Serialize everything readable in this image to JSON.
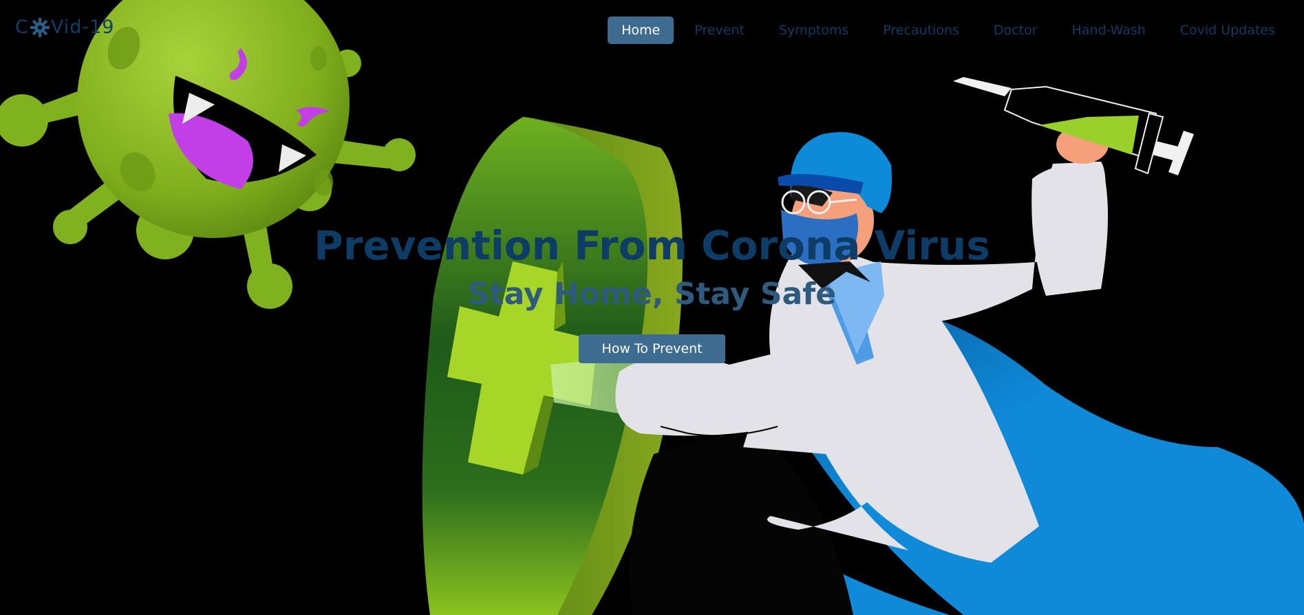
{
  "logo": {
    "text_before": "C",
    "text_after": "Vid-19",
    "icon": "virus-gear-icon"
  },
  "nav": {
    "items": [
      {
        "label": "Home",
        "active": true
      },
      {
        "label": "Prevent",
        "active": false
      },
      {
        "label": "Symptoms",
        "active": false
      },
      {
        "label": "Precautions",
        "active": false
      },
      {
        "label": "Doctor",
        "active": false
      },
      {
        "label": "Hand-Wash",
        "active": false
      },
      {
        "label": "Covid Updates",
        "active": false
      }
    ]
  },
  "hero": {
    "title": "Prevention From Corona Virus",
    "subtitle": "Stay Home, Stay Safe",
    "button_label": "How To Prevent"
  },
  "illustration": {
    "virus": "virus-monster-illustration",
    "shield": "medical-shield-illustration",
    "doctor": "doctor-hero-illustration",
    "syringe": "syringe-illustration"
  },
  "colors": {
    "background": "#000000",
    "accent": "#3e6b90",
    "title": "#0d3d66",
    "virus_green": "#8fbf1f",
    "cape_blue": "#0d8ad9",
    "virus_mouth": "#c23ee6"
  }
}
